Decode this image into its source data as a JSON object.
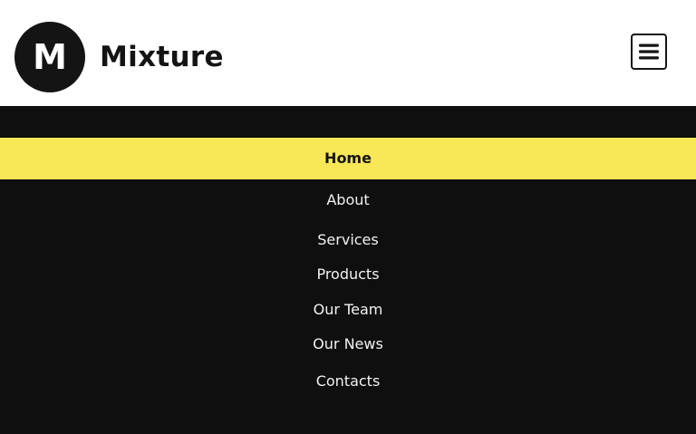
{
  "header": {
    "logo_letter": "M",
    "brand_name": "Mixture",
    "menu_icon": "hamburger-icon"
  },
  "nav": {
    "items": [
      {
        "label": "Home",
        "active": true
      },
      {
        "label": "About",
        "active": false
      },
      {
        "label": "Services",
        "active": false
      },
      {
        "label": "Products",
        "active": false
      },
      {
        "label": "Our Team",
        "active": false
      },
      {
        "label": "Our News",
        "active": false
      },
      {
        "label": "Contacts",
        "active": false
      }
    ]
  },
  "colors": {
    "background": "#0f0f0f",
    "header": "#ffffff",
    "active_highlight": "#f8e756",
    "text_light": "#f2f2f2",
    "text_dark": "#141414"
  }
}
